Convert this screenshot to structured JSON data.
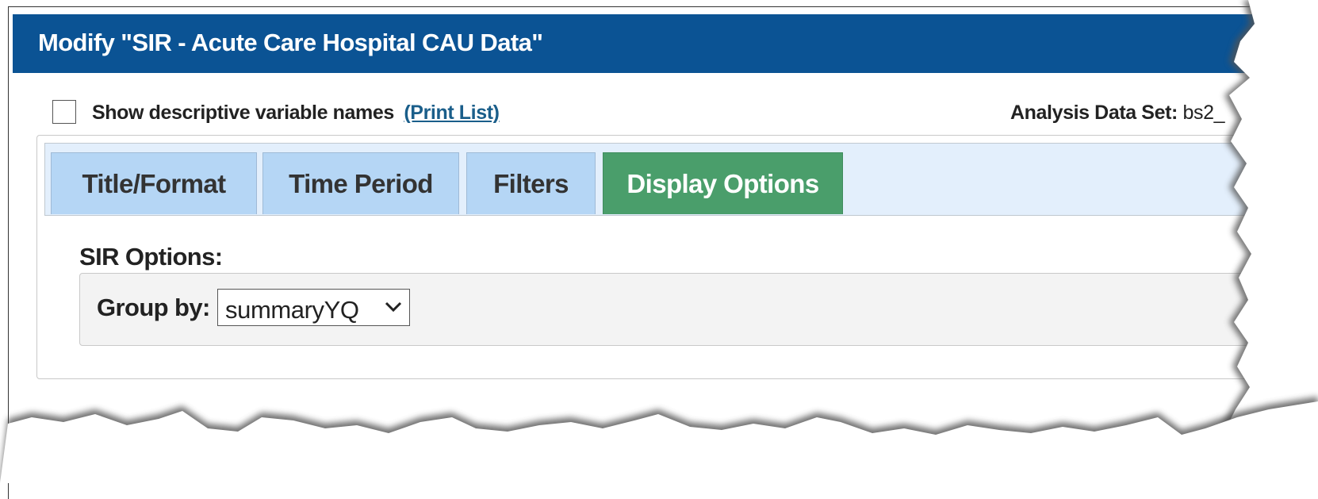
{
  "header": {
    "title": "Modify \"SIR - Acute Care Hospital CAU Data\""
  },
  "options": {
    "descriptive_label": "Show descriptive variable names",
    "print_list_label": "(Print List)",
    "dataset_label": "Analysis Data Set:",
    "dataset_value": "bs2_"
  },
  "tabs": [
    {
      "label": "Title/Format"
    },
    {
      "label": "Time Period"
    },
    {
      "label": "Filters"
    },
    {
      "label": "Display Options",
      "active": true
    }
  ],
  "sir": {
    "section_label": "SIR Options:",
    "group_by_label": "Group by:",
    "group_by_value": "summaryYQ"
  },
  "colors": {
    "title_bar": "#0b5394",
    "tab_inactive": "#b5d6f5",
    "tab_active": "#4a9e6b",
    "link": "#1a5e8a"
  }
}
